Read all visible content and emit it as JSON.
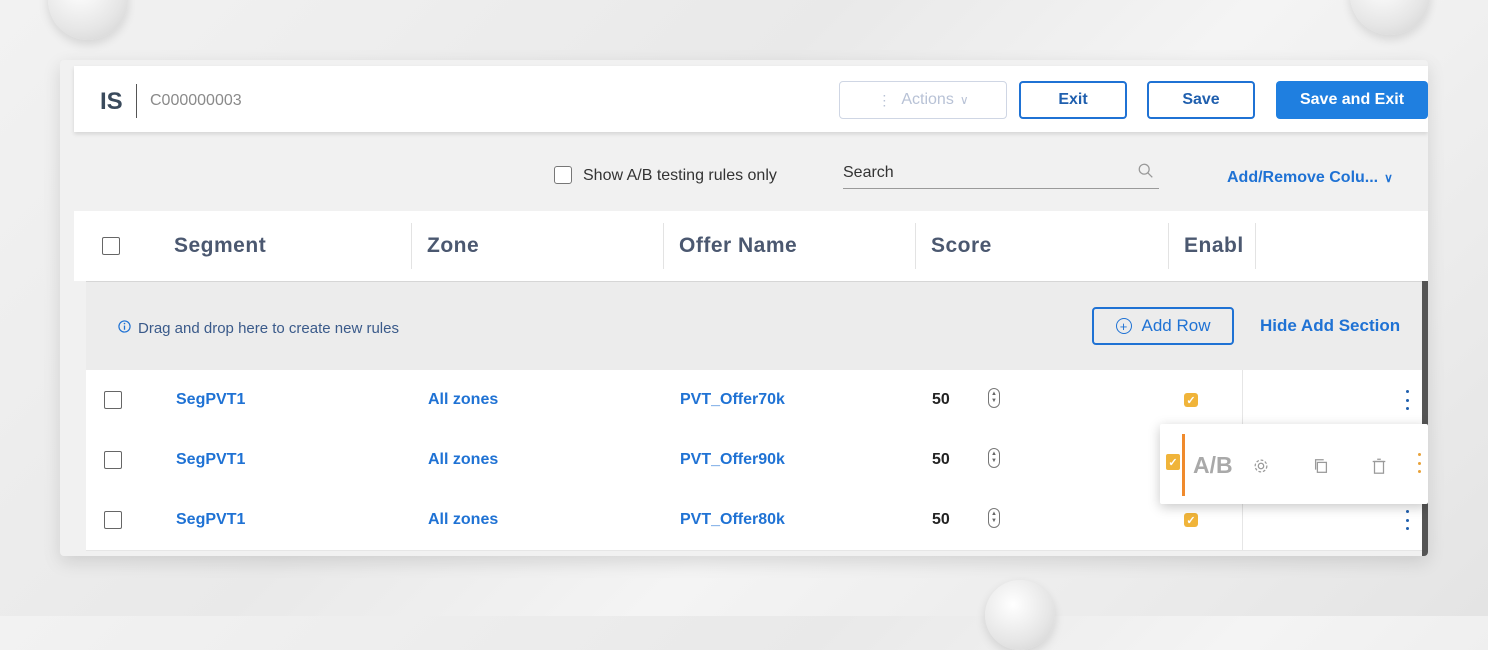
{
  "header": {
    "brand": "IS",
    "record_id": "C000000003",
    "actions_label": "Actions",
    "exit_label": "Exit",
    "save_label": "Save",
    "save_exit_label": "Save and Exit"
  },
  "toolbar": {
    "ab_only_label": "Show A/B testing rules only",
    "search_placeholder": "Search",
    "add_remove_label": "Add/Remove Colu..."
  },
  "columns": [
    "Segment",
    "Zone",
    "Offer Name",
    "Score",
    "Enabl"
  ],
  "add_section": {
    "drag_hint": "Drag and drop here to create new rules",
    "add_row_label": "Add Row",
    "hide_label": "Hide Add Section"
  },
  "rows": [
    {
      "segment": "SegPVT1",
      "zone": "All zones",
      "offer": "PVT_Offer70k",
      "score": "50",
      "enabled": true
    },
    {
      "segment": "SegPVT1",
      "zone": "All zones",
      "offer": "PVT_Offer90k",
      "score": "50",
      "enabled": true
    },
    {
      "segment": "SegPVT1",
      "zone": "All zones",
      "offer": "PVT_Offer80k",
      "score": "50",
      "enabled": true
    }
  ],
  "row_menu": {
    "ab_label": "A/B",
    "icons": [
      "gear-icon",
      "copy-icon",
      "trash-icon"
    ]
  },
  "colors": {
    "accent": "#1f72d4",
    "primary_button": "#1f7fe0",
    "checkbox_checked": "#f0b43a",
    "ab_marker": "#f08a2c"
  }
}
